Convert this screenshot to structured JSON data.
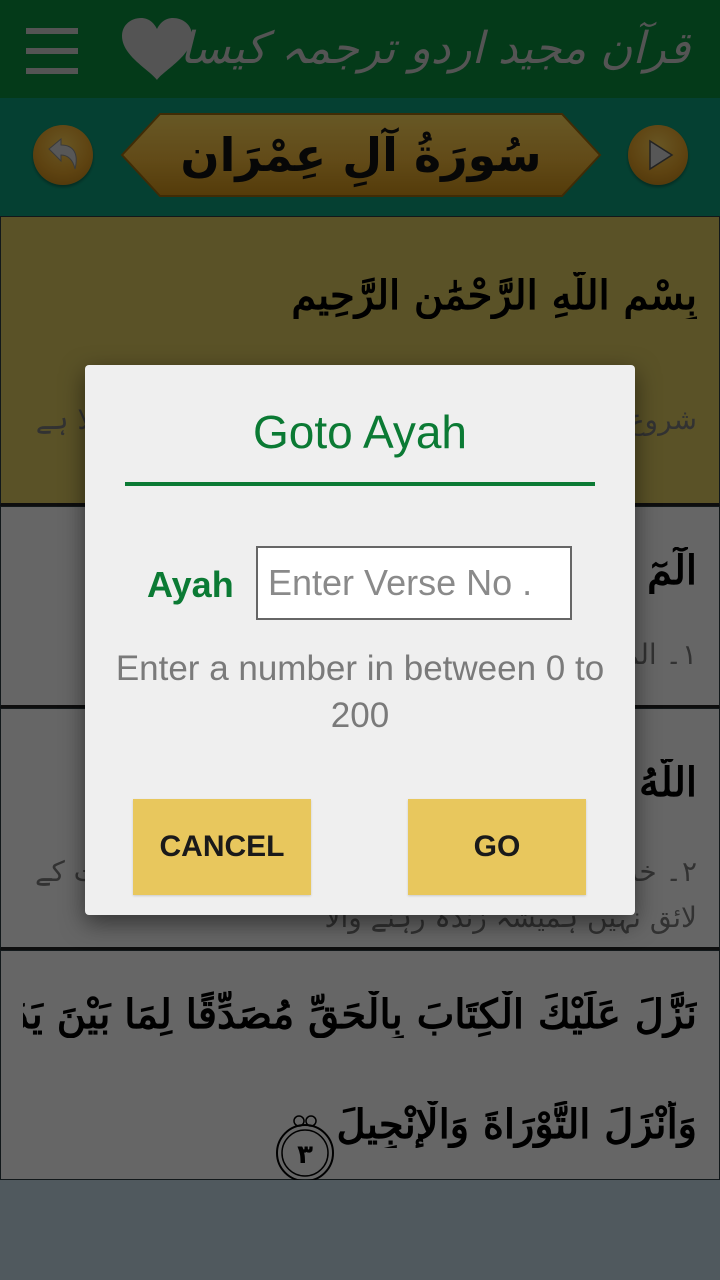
{
  "appbar": {
    "title": "قرآن مجید اردو ترجمہ کیساتھ",
    "menu_icon": "hamburger-menu-icon",
    "favorite_icon": "heart-icon"
  },
  "surah_header": {
    "name": "سُورَةُ آلِ عِمْرَان",
    "back_icon": "back-arrow-icon",
    "next_icon": "play-next-icon"
  },
  "content": {
    "bismillah": "بِسْمِ اللَّهِ الرَّحْمَٰنِ الرَّحِيمِ",
    "bismillah_translation": "شروع اللہ کا نام لے کر جو بڑا مہربان نہایت رحم والا ہے",
    "verses": [
      {
        "number": "١",
        "arabic": "الٓمٓ",
        "translation": "١۔ الم"
      },
      {
        "number": "٢",
        "arabic": "اللَّهُ لَا إِلَٰهَ إِلَّا هُوَ الْحَيُّ الْقَيُّومُ",
        "translation": "٢۔ خدا (جو معبود برحق ہے) اس کے سوا کوئی عبادت کے لائق نہیں ہمیشہ زندہ رہنے والا"
      },
      {
        "number": "٣",
        "arabic_line1": "نَزَّلَ عَلَيْكَ الْكِتَابَ بِالْحَقِّ مُصَدِّقًا لِمَا بَيْنَ يَدَيْهِ",
        "arabic_line2": "وَأَنْزَلَ التَّوْرَاةَ وَالْإِنْجِيلَ",
        "marker": "٣"
      }
    ]
  },
  "dialog": {
    "title": "Goto Ayah",
    "field_label": "Ayah",
    "input_value": "",
    "input_placeholder": "Enter Verse No .",
    "hint": "Enter a number in between 0 to 200",
    "range_min": 0,
    "range_max": 200,
    "cancel_label": "CANCEL",
    "go_label": "GO"
  },
  "colors": {
    "appbar": "#0a8a3c",
    "surah_bar": "#0e9a78",
    "accent_green": "#0b7a34",
    "button_gold": "#e8c75d",
    "bismillah_bg": "#d6c35e"
  }
}
